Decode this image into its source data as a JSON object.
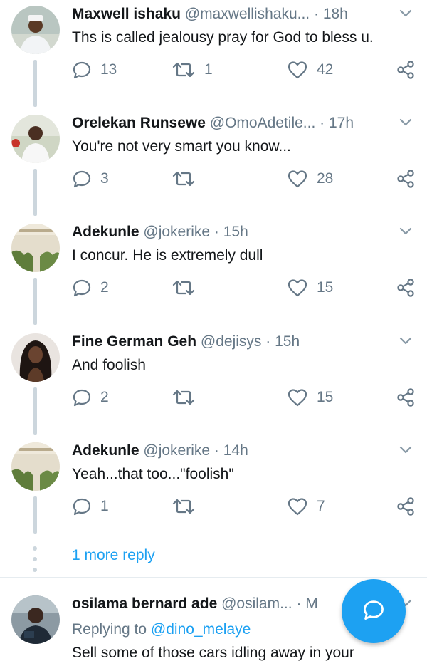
{
  "tweets": [
    {
      "name": "Maxwell ishaku",
      "handle": "@maxwellishaku...",
      "sep": "·",
      "time": "18h",
      "text": "Ths is called jealousy  pray for God to bless u.",
      "replies": "13",
      "retweets": "1",
      "likes": "42",
      "avatar": "man in white cap and white attire"
    },
    {
      "name": "Orelekan Runsewe",
      "handle": "@OmoAdetile...",
      "sep": "·",
      "time": "17h",
      "text": "You're not very smart you know...",
      "replies": "3",
      "retweets": "",
      "likes": "28",
      "avatar": "man in white shirt outdoors"
    },
    {
      "name": "Adekunle",
      "handle": "@jokerike",
      "sep": "·",
      "time": "15h",
      "text": "I concur. He is extremely dull",
      "replies": "2",
      "retweets": "",
      "likes": "15",
      "avatar": "sign with plants"
    },
    {
      "name": "Fine German Geh",
      "handle": "@dejisys",
      "sep": "·",
      "time": "15h",
      "text": "And foolish",
      "replies": "2",
      "retweets": "",
      "likes": "15",
      "avatar": "woman with dark hair"
    },
    {
      "name": "Adekunle",
      "handle": "@jokerike",
      "sep": "·",
      "time": "14h",
      "text": "Yeah...that too...\"foolish\"",
      "replies": "1",
      "retweets": "",
      "likes": "7",
      "avatar": "sign with plants"
    }
  ],
  "more_replies": "1 more reply",
  "last_tweet": {
    "name": "osilama bernard ade",
    "handle": "@osilam...",
    "sep": "·",
    "time": "M",
    "replying_label": "Replying to",
    "replying_to": "@dino_melaye",
    "text": "Sell some of those cars idling away in your"
  },
  "colors": {
    "accent": "#1da1f2",
    "muted": "#657786",
    "thread": "#ccd6dd"
  },
  "icons": [
    "reply-icon",
    "retweet-icon",
    "like-icon",
    "share-icon",
    "chevron-down-icon",
    "compose-reply-icon"
  ]
}
